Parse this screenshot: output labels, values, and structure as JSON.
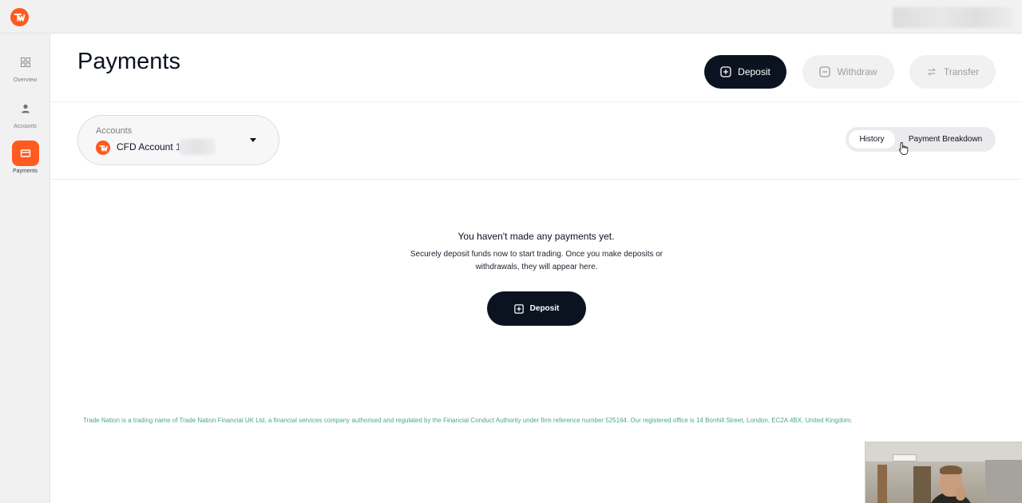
{
  "topbar": {
    "logo": "trade-nation-logo"
  },
  "sidebar": {
    "items": [
      {
        "label": "Overview",
        "icon": "grid-icon",
        "active": false
      },
      {
        "label": "Accounts",
        "icon": "user-icon",
        "active": false
      },
      {
        "label": "Payments",
        "icon": "card-icon",
        "active": true
      }
    ]
  },
  "header": {
    "title": "Payments",
    "actions": {
      "deposit": "Deposit",
      "withdraw": "Withdraw",
      "transfer": "Transfer"
    }
  },
  "filters": {
    "account_select": {
      "label": "Accounts",
      "value": "CFD Account 1"
    },
    "view_toggle": {
      "options": [
        "History",
        "Payment Breakdown"
      ],
      "selected": "History"
    }
  },
  "empty_state": {
    "title": "You haven't made any payments yet.",
    "body": "Securely deposit funds now to start trading. Once you make deposits or withdrawals, they will appear here.",
    "cta": "Deposit"
  },
  "footer": {
    "legal": "Trade Nation is a trading name of Trade Nation Financial UK Ltd, a financial services company authorised and regulated by the Financial Conduct Authority under firm reference number 525164. Our registered office is 14 Bonhill Street, London, EC2A 4BX, United Kingdom."
  },
  "colors": {
    "brand": "#ff5a1f",
    "primary": "#0b1220",
    "footer_text": "#4aa985"
  }
}
